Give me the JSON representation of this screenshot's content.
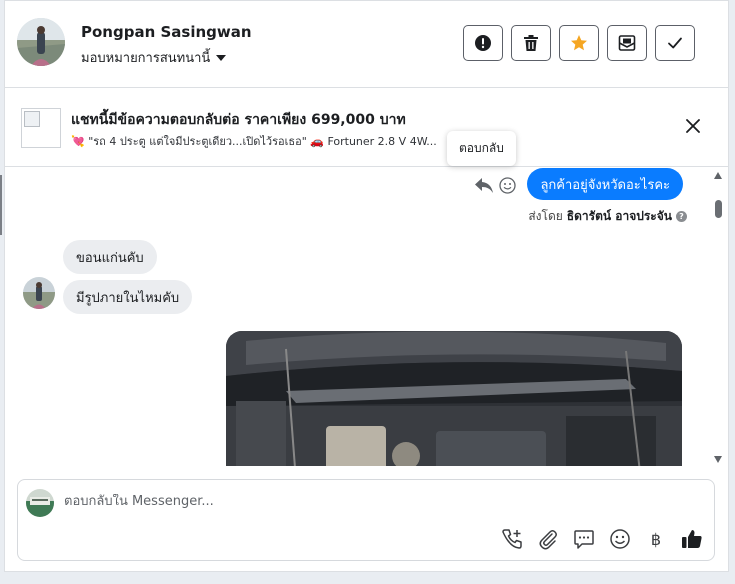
{
  "header": {
    "contact_name": "Pongpan Sasingwan",
    "assign_label": "มอบหมายการสนทนานี้",
    "actions": [
      {
        "icon": "alert-circle-icon"
      },
      {
        "icon": "trash-icon"
      },
      {
        "icon": "star-icon"
      },
      {
        "icon": "mark-unread-icon"
      },
      {
        "icon": "check-icon"
      }
    ]
  },
  "banner": {
    "title": "แชทนี้มีข้อความตอบกลับต่อ ราคาเพียง 699,000 บาท",
    "subtitle": "💘 \"รถ 4 ประตู แต่ใจมีประตูเดียว...เปิดไว้รอเธอ\" 🚗 Fortuner 2.8 V 4W..."
  },
  "tooltip": {
    "text": "ตอบกลับ"
  },
  "messages": {
    "outgoing": "ลูกค้าอยู่จังหวัดอะไรคะ",
    "sent_by_prefix": "ส่งโดย",
    "sent_by_name": "ธิดารัตน์ อาจประจัน",
    "help_mark": "?",
    "incoming": [
      "ขอนแก่นคับ",
      "มีรูปภายในไหมคับ"
    ]
  },
  "composer": {
    "placeholder": "ตอบกลับใน Messenger...",
    "tools": [
      "call-add-icon",
      "paperclip-icon",
      "saved-replies-icon",
      "emoji-icon",
      "baht-icon",
      "thumbs-up-icon"
    ],
    "baht_symbol": "฿"
  },
  "colors": {
    "accent": "#0a7cff",
    "star": "#f5a623",
    "incoming_bubble": "#ebedf0"
  }
}
